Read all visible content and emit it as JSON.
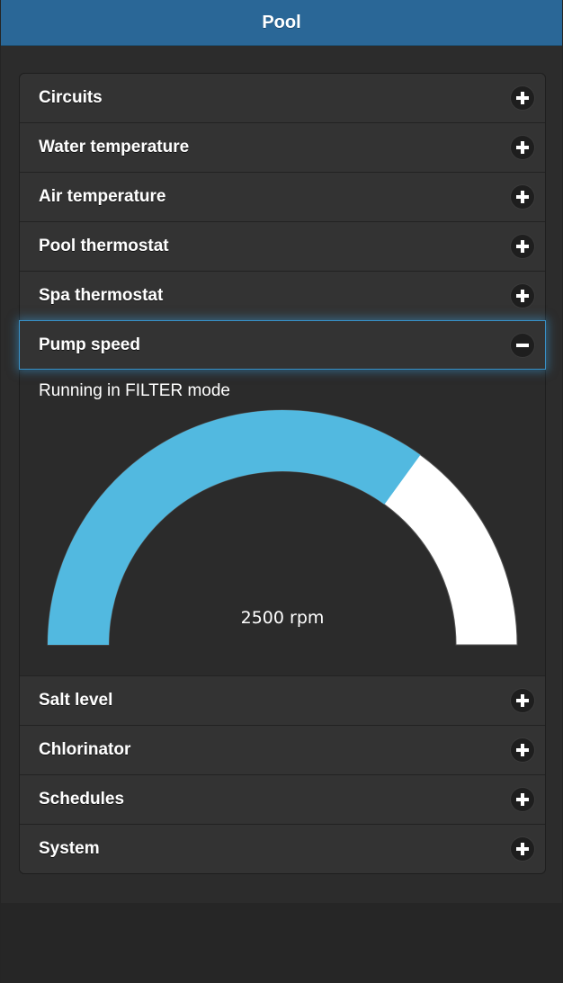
{
  "header": {
    "title": "Pool"
  },
  "sections_top": [
    {
      "label": "Circuits",
      "icon": "plus-icon"
    },
    {
      "label": "Water temperature",
      "icon": "plus-icon"
    },
    {
      "label": "Air temperature",
      "icon": "plus-icon"
    },
    {
      "label": "Pool thermostat",
      "icon": "plus-icon"
    },
    {
      "label": "Spa thermostat",
      "icon": "plus-icon"
    }
  ],
  "expanded_section": {
    "label": "Pump speed",
    "icon": "minus-icon",
    "status": "Running in FILTER mode",
    "gauge": {
      "value_label": "2500 rpm",
      "fraction": 0.7,
      "fill_color": "#52b9e0",
      "track_color": "#ffffff"
    }
  },
  "sections_bottom": [
    {
      "label": "Salt level",
      "icon": "plus-icon"
    },
    {
      "label": "Chlorinator",
      "icon": "plus-icon"
    },
    {
      "label": "Schedules",
      "icon": "plus-icon"
    },
    {
      "label": "System",
      "icon": "plus-icon"
    }
  ],
  "colors": {
    "header_bg": "#2a6797",
    "accent_glow": "#3892c9"
  }
}
